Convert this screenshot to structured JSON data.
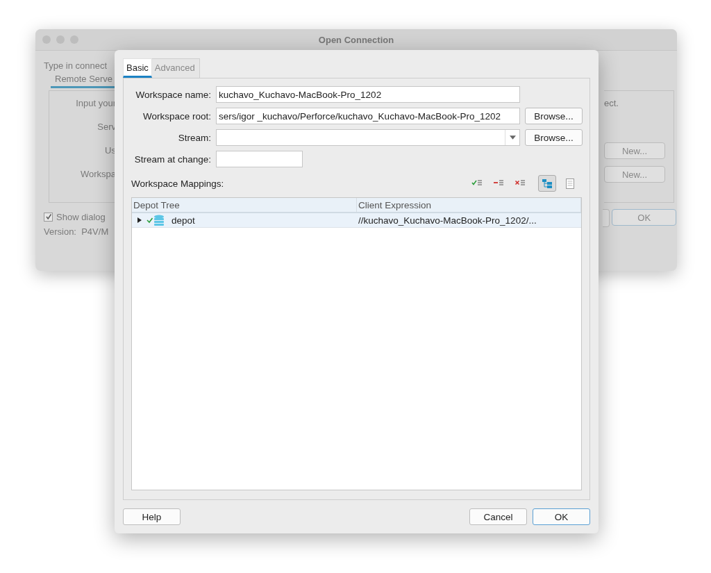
{
  "back_window": {
    "title": "Open Connection",
    "intro": "Type in connect",
    "tab": {
      "label": "Remote Serve",
      "selected": true
    },
    "rows": [
      {
        "label": "Input your",
        "right_text": "ect."
      },
      {
        "label": "Serv"
      },
      {
        "label": "Us",
        "button": "New..."
      },
      {
        "label": "Workspa",
        "button": "New..."
      }
    ],
    "show_dialog": {
      "label": "Show dialog",
      "checked": true
    },
    "version": "Version:  P4V/M",
    "ok_button": "OK"
  },
  "dialog": {
    "tabs": [
      {
        "label": "Basic",
        "selected": true
      },
      {
        "label": "Advanced",
        "selected": false
      }
    ],
    "fields": [
      {
        "label": "Workspace name:",
        "kind": "text",
        "value": "kuchavo_Kuchavo-MacBook-Pro_1202"
      },
      {
        "label": "Workspace root:",
        "kind": "text",
        "value": "sers/igor _kuchavo/Perforce/kuchavo_Kuchavo-MacBook-Pro_1202",
        "button": "Browse..."
      },
      {
        "label": "Stream:",
        "kind": "combo",
        "button": "Browse..."
      },
      {
        "label": "Stream at change:",
        "kind": "short"
      }
    ],
    "mappings_label": "Workspace Mappings:",
    "toolbar": [
      {
        "kind": "add",
        "selected": false
      },
      {
        "kind": "remove",
        "selected": false
      },
      {
        "kind": "exclude",
        "selected": false
      },
      {
        "kind": "tree",
        "selected": true
      },
      {
        "kind": "text",
        "selected": false
      }
    ],
    "table": {
      "columns": [
        "Depot Tree",
        "Client Expression"
      ],
      "rows": [
        {
          "name": "depot",
          "expression": "//kuchavo_Kuchavo-MacBook-Pro_1202/...",
          "selected": true,
          "expanded": false,
          "mapped": true
        }
      ]
    },
    "buttons": [
      {
        "label": "Help",
        "kind": "plain"
      },
      {
        "label": "Cancel",
        "kind": "plain"
      },
      {
        "label": "OK",
        "kind": "default"
      }
    ]
  }
}
